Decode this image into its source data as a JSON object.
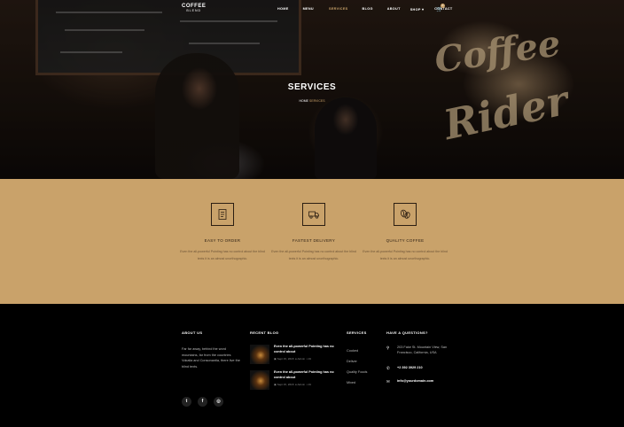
{
  "header": {
    "logo": "COFFEE",
    "logo_sub": "BLEND",
    "menu": [
      "HOME",
      "MENU",
      "SERVICES",
      "BLOG",
      "ABOUT",
      "SHOP ▾",
      "CONTACT"
    ],
    "cart_count": "0"
  },
  "hero": {
    "title": "SERVICES",
    "breadcrumb_home": "HOME",
    "breadcrumb_current": "SERVICES"
  },
  "features": [
    {
      "icon": "order-icon",
      "title": "EASY TO ORDER",
      "text": "Even the all-powerful Pointing has no control about the blind texts it is an almost unorthographic."
    },
    {
      "icon": "delivery-truck-icon",
      "title": "FASTEST DELIVERY",
      "text": "Even the all-powerful Pointing has no control about the blind texts it is an almost unorthographic."
    },
    {
      "icon": "coffee-beans-icon",
      "title": "QUALITY COFFEE",
      "text": "Even the all-powerful Pointing has no control about the blind texts it is an almost unorthographic."
    }
  ],
  "footer": {
    "about": {
      "heading": "ABOUT US",
      "text": "Far far away, behind the word mountains, far from the countries Vokalia and Consonantia, there live the blind texts."
    },
    "social": [
      "twitter-icon",
      "facebook-icon",
      "instagram-icon"
    ],
    "blog": {
      "heading": "RECENT BLOG",
      "posts": [
        {
          "title": "Even the all-powerful Pointing has no control about",
          "date": "Sept 15, 2018",
          "author": "Admin",
          "comments": "19"
        },
        {
          "title": "Even the all-powerful Pointing has no control about",
          "date": "Sept 15, 2018",
          "author": "Admin",
          "comments": "19"
        }
      ]
    },
    "services": {
      "heading": "SERVICES",
      "items": [
        "Cooked",
        "Deliver",
        "Quality Foods",
        "Mixed"
      ]
    },
    "contact": {
      "heading": "HAVE A QUESTIONS?",
      "address": "203 Fake St. Mountain View, San Francisco, California, USA",
      "phone": "+2 392 3929 210",
      "email": "info@yourdomain.com"
    }
  },
  "colors": {
    "accent": "#c9a26a",
    "dark": "#000000"
  }
}
